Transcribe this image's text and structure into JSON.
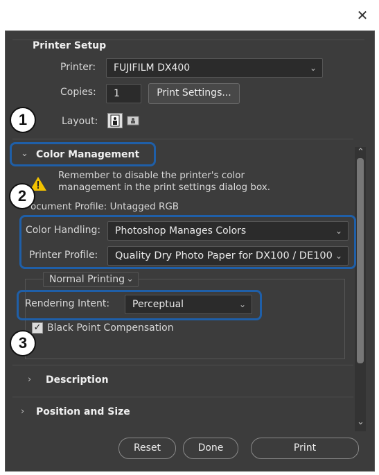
{
  "window": {
    "close_glyph": "✕"
  },
  "printer_setup": {
    "title": "Printer Setup",
    "printer_label": "Printer:",
    "printer_value": "FUJIFILM DX400",
    "copies_label": "Copies:",
    "copies_value": "1",
    "print_settings_button": "Print Settings...",
    "layout_label": "Layout:"
  },
  "color_management": {
    "title": "Color Management",
    "warning_line1": "Remember to disable the printer's color",
    "warning_line2": "management in the print settings dialog box.",
    "document_profile": "ocument Profile: Untagged RGB",
    "color_handling_label": "Color Handling:",
    "color_handling_value": "Photoshop Manages Colors",
    "printer_profile_label": "Printer Profile:",
    "printer_profile_value": "Quality Dry Photo Paper for DX100 / DE100",
    "printing_mode": "Normal Printing",
    "rendering_intent_label": "Rendering Intent:",
    "rendering_intent_value": "Perceptual",
    "black_point_label": "Black Point Compensation"
  },
  "sections": {
    "description": "Description",
    "position_size": "Position and Size"
  },
  "buttons": {
    "reset": "Reset",
    "done": "Done",
    "print": "Print"
  },
  "callouts": [
    "1",
    "2",
    "3"
  ],
  "colors": {
    "highlight": "#1f5fa8",
    "dialog_bg": "#3c3c3c",
    "field_bg": "#2b2b2b"
  }
}
